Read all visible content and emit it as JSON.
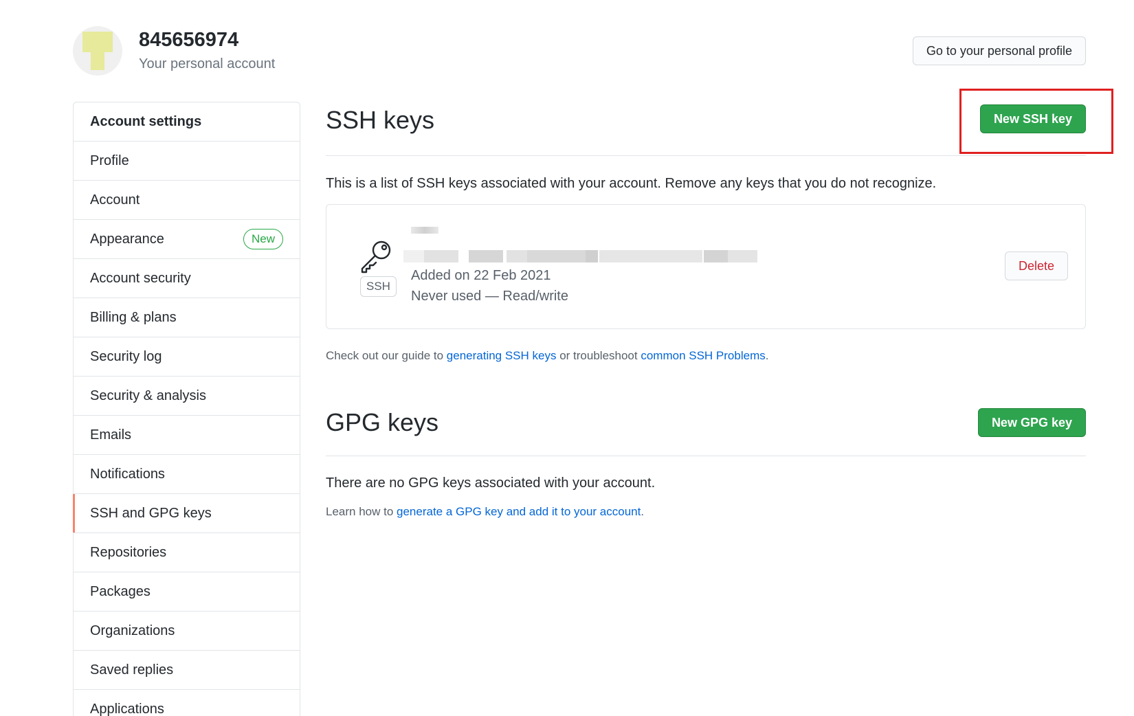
{
  "header": {
    "username": "845656974",
    "account_type": "Your personal account",
    "profile_button": "Go to your personal profile"
  },
  "sidebar": {
    "heading": "Account settings",
    "items": [
      {
        "label": "Profile"
      },
      {
        "label": "Account"
      },
      {
        "label": "Appearance",
        "badge": "New"
      },
      {
        "label": "Account security"
      },
      {
        "label": "Billing & plans"
      },
      {
        "label": "Security log"
      },
      {
        "label": "Security & analysis"
      },
      {
        "label": "Emails"
      },
      {
        "label": "Notifications"
      },
      {
        "label": "SSH and GPG keys",
        "active": true
      },
      {
        "label": "Repositories"
      },
      {
        "label": "Packages"
      },
      {
        "label": "Organizations"
      },
      {
        "label": "Saved replies"
      },
      {
        "label": "Applications"
      }
    ]
  },
  "ssh": {
    "title": "SSH keys",
    "new_button": "New SSH key",
    "intro": "This is a list of SSH keys associated with your account. Remove any keys that you do not recognize.",
    "key": {
      "type_label": "SSH",
      "added": "Added on 22 Feb 2021",
      "usage": "Never used — Read/write",
      "delete_button": "Delete",
      "icon": "key-icon"
    },
    "guide": {
      "prefix": "Check out our guide to ",
      "link1": "generating SSH keys",
      "middle": " or troubleshoot ",
      "link2": "common SSH Problems",
      "suffix": "."
    }
  },
  "gpg": {
    "title": "GPG keys",
    "new_button": "New GPG key",
    "empty": "There are no GPG keys associated with your account.",
    "learn": {
      "prefix": "Learn how to ",
      "link": "generate a GPG key and add it to your account",
      "suffix": "."
    }
  },
  "colors": {
    "primary_green": "#2ea44f",
    "link_blue": "#0366d6",
    "danger_red": "#cb2431",
    "active_marker": "#f9826c",
    "annotation_red": "#e02020"
  }
}
